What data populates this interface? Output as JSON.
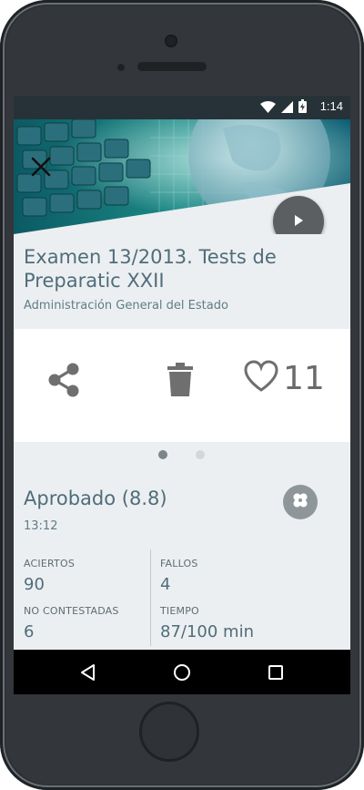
{
  "status_bar": {
    "time": "1:14"
  },
  "exam": {
    "title": "Examen 13/2013. Tests de Preparatic XXII",
    "subtitle": "Administración General del Estado"
  },
  "actions": {
    "likes_count": "11"
  },
  "result": {
    "status": "Aprobado (8.8)",
    "time": "13:12",
    "stats": {
      "aciertos_label": "ACIERTOS",
      "aciertos_value": "90",
      "fallos_label": "FALLOS",
      "fallos_value": "4",
      "no_contestadas_label": "NO CONTESTADAS",
      "no_contestadas_value": "6",
      "tiempo_label": "TIEMPO",
      "tiempo_value": "87/100 min"
    }
  },
  "pager": {
    "active_index": 0,
    "count": 2
  },
  "colors": {
    "accent_text": "#4f6d7a",
    "status_bar": "#263238",
    "screen_bg": "#eceff1"
  },
  "icons": [
    "close-icon",
    "play-icon",
    "share-icon",
    "trash-icon",
    "heart-icon",
    "bandage-icon",
    "back-icon",
    "home-icon",
    "recents-icon",
    "wifi-icon",
    "signal-icon",
    "battery-icon"
  ]
}
